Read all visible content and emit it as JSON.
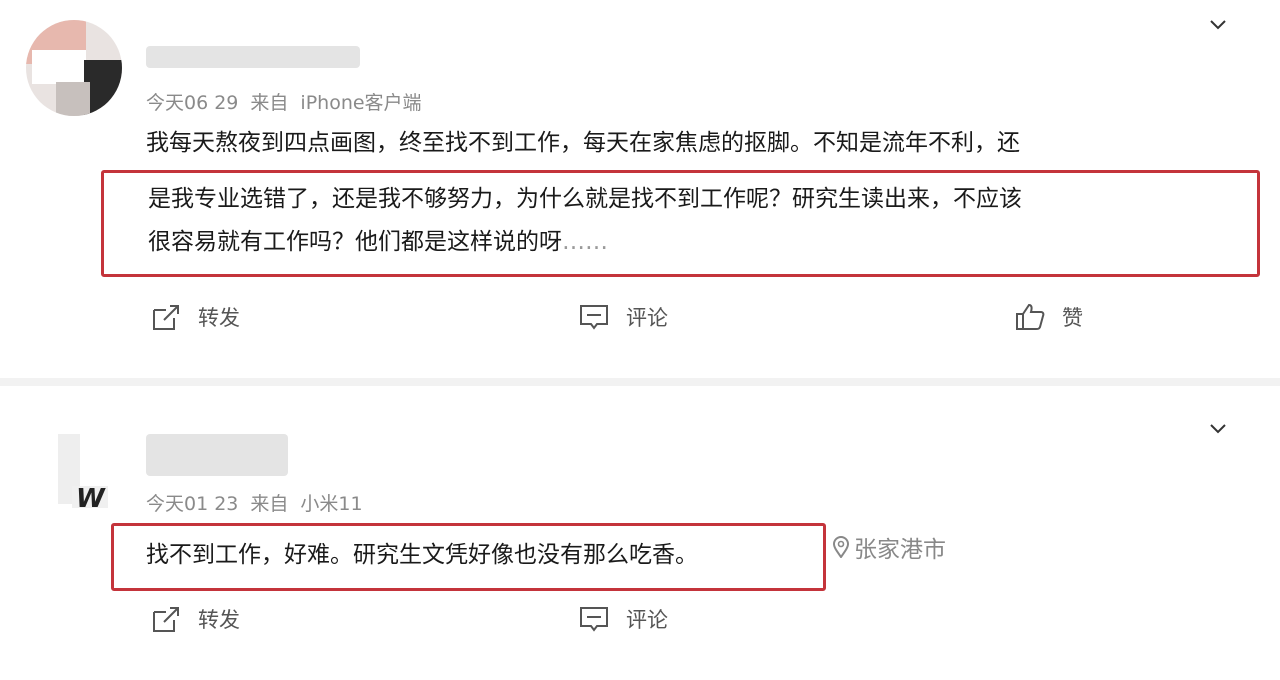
{
  "posts": [
    {
      "meta": {
        "time": "今天06 29",
        "source_prefix": "来自",
        "source": "iPhone客户端"
      },
      "text_line0": "我每天熬夜到四点画图，终至找不到工作，每天在家焦虑的抠脚。不知是流年不利，还",
      "highlight_lines": [
        "是我专业选错了，还是我不够努力，为什么就是找不到工作呢？研究生读出来，不应该",
        "很容易就有工作吗？他们都是这样说的呀"
      ],
      "ellipsis": "……",
      "actions": {
        "repost": "转发",
        "comment": "评论",
        "like": "赞"
      }
    },
    {
      "meta": {
        "time": "今天01 23",
        "source_prefix": "来自",
        "source": "小米11"
      },
      "highlight_text": "找不到工作，好难。研究生文凭好像也没有那么吃香。",
      "location": "张家港市",
      "actions": {
        "repost": "转发",
        "comment": "评论"
      }
    }
  ],
  "colors": {
    "highlight_border": "#c4343b",
    "meta_text": "#8a8a8a"
  },
  "icons": [
    "chevron-down-icon",
    "repost-icon",
    "comment-icon",
    "like-icon",
    "location-pin-icon"
  ]
}
